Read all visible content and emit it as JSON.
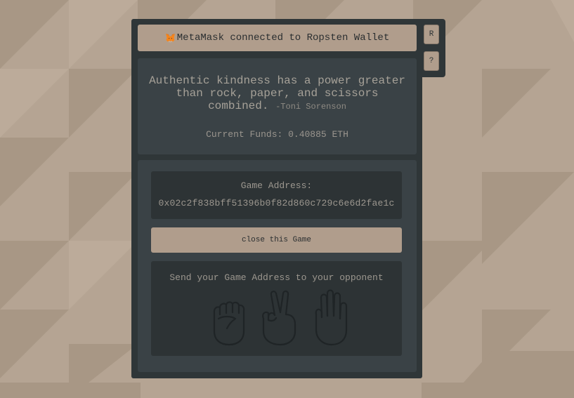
{
  "status": {
    "icon": "metamask-fox-icon",
    "text": "MetaMask connected to Ropsten Wallet"
  },
  "side_buttons": {
    "reset_label": "R",
    "help_label": "?"
  },
  "quote": {
    "text": "Authentic kindness has a power greater than rock, paper, and scissors combined.",
    "author": "-Toni Sorenson"
  },
  "funds": {
    "text": "Current Funds: 0.40885 ETH"
  },
  "game": {
    "address_label": "Game Address:",
    "address_value": "0x02c2f838bff51396b0f82d860c729c6e6d2fae1c",
    "close_label": "close this Game",
    "send_instruction": "Send your Game Address to your opponent",
    "hand_icons": [
      "rock-fist-icon",
      "scissors-hand-icon",
      "paper-hand-icon"
    ]
  },
  "colors": {
    "background": "#b5a493",
    "panel": "#2f3638",
    "card": "#3a4246",
    "inset": "#2d3335",
    "accent": "#b09d8c"
  }
}
